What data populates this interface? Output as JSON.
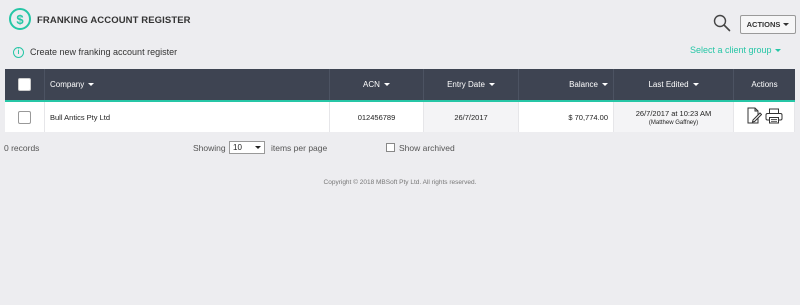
{
  "header": {
    "logo_symbol": "$",
    "title": "FRANKING ACCOUNT REGISTER",
    "actions_label": "ACTIONS"
  },
  "create": {
    "icon": "info-icon",
    "label": "Create new franking account register"
  },
  "client_group": {
    "label": "Select a client group"
  },
  "table": {
    "columns": [
      {
        "key": "select",
        "label": ""
      },
      {
        "key": "company",
        "label": "Company",
        "sortable": true
      },
      {
        "key": "acn",
        "label": "ACN",
        "sortable": true
      },
      {
        "key": "entry_date",
        "label": "Entry Date",
        "sortable": true
      },
      {
        "key": "balance",
        "label": "Balance",
        "sortable": true
      },
      {
        "key": "last_edited",
        "label": "Last Edited",
        "sortable": true
      },
      {
        "key": "actions",
        "label": "Actions"
      }
    ],
    "rows": [
      {
        "company": "Bull Antics Pty Ltd",
        "acn": "012456789",
        "entry_date": "26/7/2017",
        "balance": "$ 70,774.00",
        "last_edited": "26/7/2017 at 10:23 AM",
        "edited_by": "(Matthew Gaffney)"
      }
    ]
  },
  "footer": {
    "records": "0 records",
    "showing": "Showing",
    "per_page_value": "10",
    "items_per_page": "items per page",
    "show_archived": "Show archived"
  },
  "copyright": "Copyright © 2018 MBSoft Pty Ltd. All rights reserved.",
  "colors": {
    "accent": "#26c6a6",
    "header_bg": "#3e4452",
    "page_bg": "#ededf0"
  }
}
